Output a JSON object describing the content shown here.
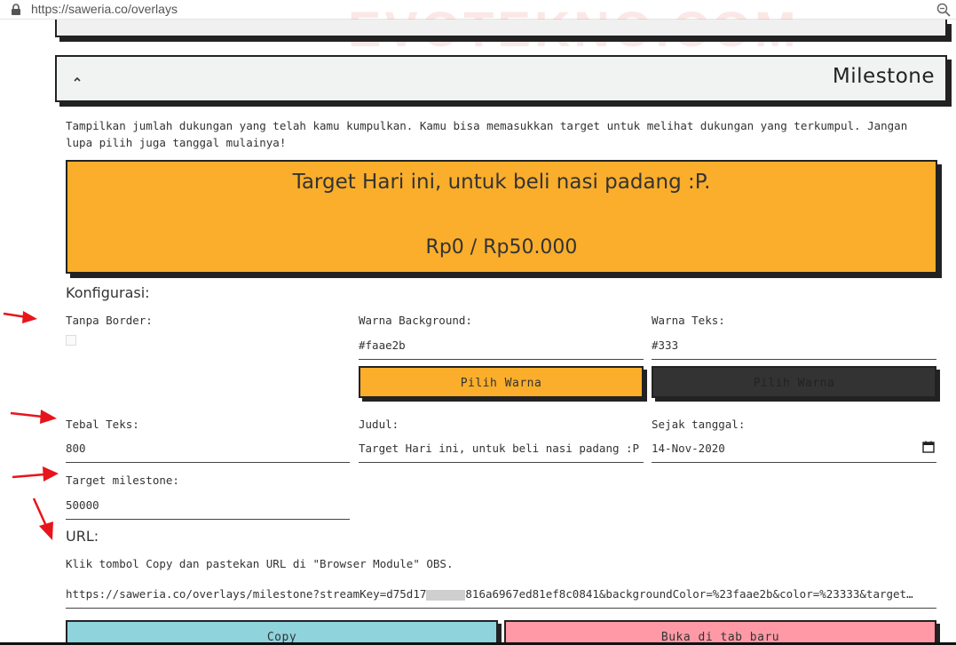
{
  "browser": {
    "url": "https://saweria.co/overlays",
    "watermark": "EVOTEKNO.COM"
  },
  "milestone": {
    "title": "Milestone",
    "description": "Tampilkan jumlah dukungan yang telah kamu kumpulkan. Kamu bisa memasukkan target untuk melihat dukungan yang terkumpul. Jangan lupa pilih juga tanggal mulainya!",
    "preview": {
      "title": "Target Hari ini, untuk beli nasi padang :P.",
      "amount": "Rp0 / Rp50.000",
      "background_color": "#faae2b",
      "text_color": "#333"
    }
  },
  "config": {
    "heading": "Konfigurasi:",
    "no_border_label": "Tanpa Border:",
    "bg_color_label": "Warna Background:",
    "bg_color_value": "#faae2b",
    "text_color_label": "Warna Teks:",
    "text_color_value": "#333",
    "pick_color_label": "Pilih Warna",
    "font_weight_label": "Tebal Teks:",
    "font_weight_value": "800",
    "title_label": "Judul:",
    "title_value": "Target Hari ini, untuk beli nasi padang :P",
    "since_label": "Sejak tanggal:",
    "since_value": "14-Nov-2020",
    "target_label": "Target milestone:",
    "target_value": "50000"
  },
  "url_section": {
    "heading": "URL:",
    "instruction": "Klik tombol Copy dan pastekan URL di \"Browser Module\" OBS.",
    "url_start": "https://saweria.co/overlays/milestone?streamKey=d75d17",
    "url_end": "816a6967ed81ef8c0841&backgroundColor=%23faae2b&color=%23333&target…",
    "copy_label": "Copy",
    "open_tab_label": "Buka di tab baru"
  },
  "colors": {
    "accent_orange": "#faae2b",
    "dark": "#333333",
    "copy_button": "#8fd3dd",
    "open_button": "#ff99a6",
    "annotation_arrow": "#e8141c"
  }
}
